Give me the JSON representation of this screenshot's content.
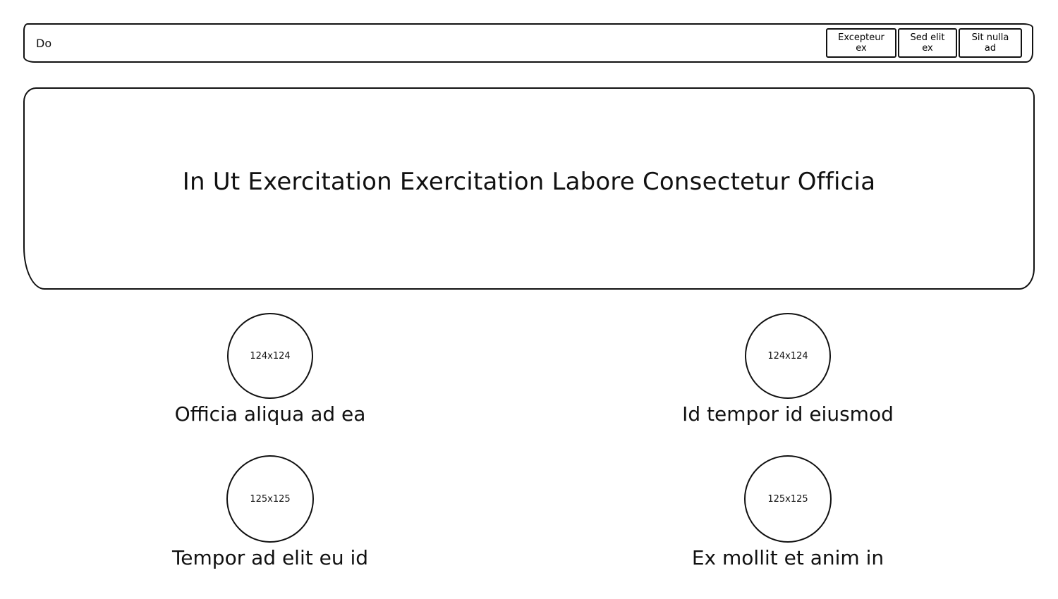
{
  "header": {
    "brand": "Do",
    "buttons": [
      {
        "label": "Excepteur ex"
      },
      {
        "label": "Sed elit ex"
      },
      {
        "label": "Sit nulla ad"
      }
    ]
  },
  "hero": {
    "title": "In Ut Exercitation Exercitation Labore Consectetur Officia"
  },
  "cards": [
    {
      "image": "124x124",
      "label": "Officia aliqua ad ea"
    },
    {
      "image": "124x124",
      "label": "Id tempor id eiusmod"
    },
    {
      "image": "125x125",
      "label": "Tempor ad elit eu id"
    },
    {
      "image": "125x125",
      "label": "Ex mollit et anim in"
    }
  ]
}
